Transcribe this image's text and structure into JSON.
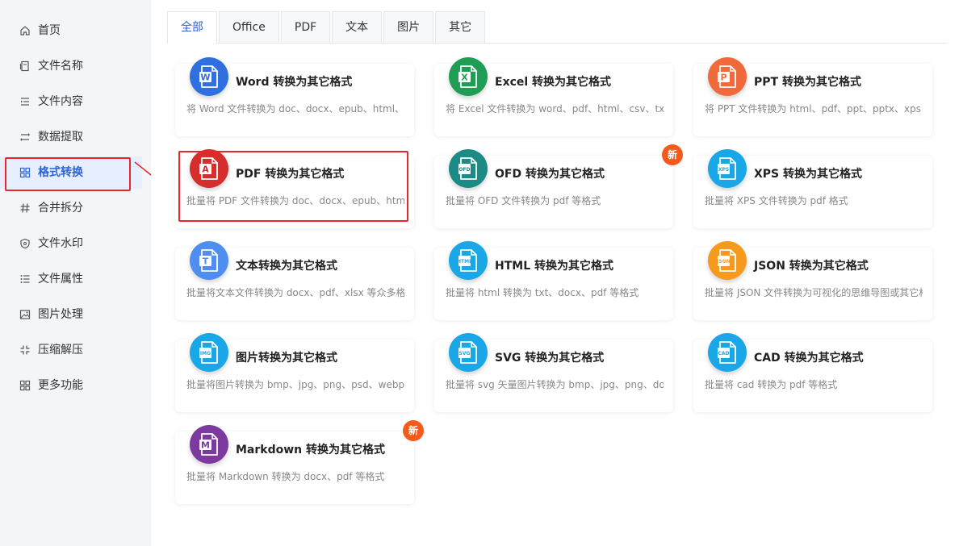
{
  "sidebar": {
    "items": [
      {
        "label": "首页",
        "icon": "home-icon"
      },
      {
        "label": "文件名称",
        "icon": "file-rename-icon"
      },
      {
        "label": "文件内容",
        "icon": "content-list-icon"
      },
      {
        "label": "数据提取",
        "icon": "extract-icon"
      },
      {
        "label": "格式转换",
        "icon": "convert-grid-icon",
        "active": true
      },
      {
        "label": "合并拆分",
        "icon": "hash-icon"
      },
      {
        "label": "文件水印",
        "icon": "watermark-shield-icon"
      },
      {
        "label": "文件属性",
        "icon": "properties-list-icon"
      },
      {
        "label": "图片处理",
        "icon": "image-icon"
      },
      {
        "label": "压缩解压",
        "icon": "compress-icon"
      },
      {
        "label": "更多功能",
        "icon": "more-grid-icon"
      }
    ]
  },
  "tabs": [
    {
      "label": "全部",
      "active": true
    },
    {
      "label": "Office"
    },
    {
      "label": "PDF"
    },
    {
      "label": "文本"
    },
    {
      "label": "图片"
    },
    {
      "label": "其它"
    }
  ],
  "cards": [
    {
      "title": "Word 转换为其它格式",
      "desc": "将 Word 文件转换为 doc、docx、epub、html、pdf",
      "glyph": "W",
      "color": "#2f6fe0",
      "icon": "word-icon"
    },
    {
      "title": "Excel 转换为其它格式",
      "desc": "将 Excel 文件转换为 word、pdf、html、csv、txt、s",
      "glyph": "X",
      "color": "#1f9d55",
      "icon": "excel-icon"
    },
    {
      "title": "PPT 转换为其它格式",
      "desc": "将 PPT 文件转换为 html、pdf、ppt、pptx、xps 等",
      "glyph": "P",
      "color": "#f06a3c",
      "icon": "ppt-icon"
    },
    {
      "title": "PDF 转换为其它格式",
      "desc": "批量将 PDF 文件转换为 doc、docx、epub、html、",
      "glyph": "A",
      "color": "#d62d2d",
      "icon": "pdf-icon"
    },
    {
      "title": "OFD 转换为其它格式",
      "desc": "批量将 OFD 文件转换为 pdf 等格式",
      "glyph": "OFD",
      "color": "#1c8b86",
      "icon": "ofd-icon",
      "new": "新"
    },
    {
      "title": "XPS 转换为其它格式",
      "desc": "批量将 XPS 文件转换为 pdf 格式",
      "glyph": "XPS",
      "color": "#1aa7e8",
      "icon": "xps-icon"
    },
    {
      "title": "文本转换为其它格式",
      "desc": "批量将文本文件转换为 docx、pdf、xlsx 等众多格式",
      "glyph": "T",
      "color": "#4f8ef0",
      "icon": "text-icon"
    },
    {
      "title": "HTML 转换为其它格式",
      "desc": "批量将 html 转换为 txt、docx、pdf 等格式",
      "glyph": "HTML",
      "color": "#1aa7e8",
      "icon": "html-icon"
    },
    {
      "title": "JSON 转换为其它格式",
      "desc": "批量将 JSON 文件转换为可视化的思维导图或其它格",
      "glyph": "JSON",
      "color": "#f59a1e",
      "icon": "json-icon"
    },
    {
      "title": "图片转换为其它格式",
      "desc": "批量将图片转换为 bmp、jpg、png、psd、webp、",
      "glyph": "IMG",
      "color": "#1aa7e8",
      "icon": "image-convert-icon"
    },
    {
      "title": "SVG 转换为其它格式",
      "desc": "批量将 svg 矢量图片转换为 bmp、jpg、png、docx",
      "glyph": "SVG",
      "color": "#1aa7e8",
      "icon": "svg-icon"
    },
    {
      "title": "CAD 转换为其它格式",
      "desc": "批量将 cad 转换为 pdf 等格式",
      "glyph": "CAD",
      "color": "#1aa7e8",
      "icon": "cad-icon"
    },
    {
      "title": "Markdown 转换为其它格式",
      "desc": "批量将 Markdown 转换为 docx、pdf 等格式",
      "glyph": "M",
      "color": "#7c3a9e",
      "icon": "markdown-icon",
      "new": "新"
    }
  ]
}
